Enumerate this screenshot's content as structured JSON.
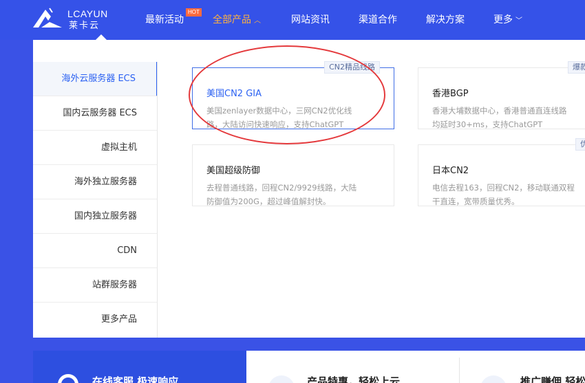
{
  "logo": {
    "top": "LCAYUN",
    "bottom": "莱卡云"
  },
  "nav": {
    "items": [
      {
        "label": "最新活动"
      },
      {
        "label": "全部产品"
      },
      {
        "label": "网站资讯"
      },
      {
        "label": "渠道合作"
      },
      {
        "label": "解决方案"
      },
      {
        "label": "更多"
      }
    ],
    "hot_badge": "HOT"
  },
  "sidebar": {
    "items": [
      {
        "label": "海外云服务器 ECS"
      },
      {
        "label": "国内云服务器 ECS"
      },
      {
        "label": "虚拟主机"
      },
      {
        "label": "海外独立服务器"
      },
      {
        "label": "国内独立服务器"
      },
      {
        "label": "CDN"
      },
      {
        "label": "站群服务器"
      },
      {
        "label": "更多产品"
      }
    ]
  },
  "cards": [
    {
      "tag": "CN2精品线路",
      "title": "美国CN2 GIA",
      "desc1": "美国zenlayer数据中心，三网CN2优化线",
      "desc2": "路，大陆访问快速响应，支持ChatGPT"
    },
    {
      "tag": "爆款销",
      "title": "香港BGP",
      "desc1": "香港大埔数据中心，香港普通直连线路",
      "desc2": "均延时30+ms，支持ChatGPT"
    },
    {
      "tag": "",
      "title": "美国超级防御",
      "desc1": "去程普通线路，回程CN2/9929线路，大陆",
      "desc2": "防御值为200G，超过峰值解封快。"
    },
    {
      "tag": "优质",
      "title": "日本CN2",
      "desc1": "电信去程163，回程CN2，移动联通双程",
      "desc2": "干直连，宽带质量优秀。"
    }
  ],
  "bottom": {
    "left": "在线客服 极速响应",
    "middle": "产品特惠，轻松上云",
    "right": "推广赚佣 轻松"
  },
  "colors": {
    "header_bg": "#3552e8",
    "accent": "#2c62f2",
    "nav_active": "#ffb23e",
    "highlight": "#e4393c"
  }
}
